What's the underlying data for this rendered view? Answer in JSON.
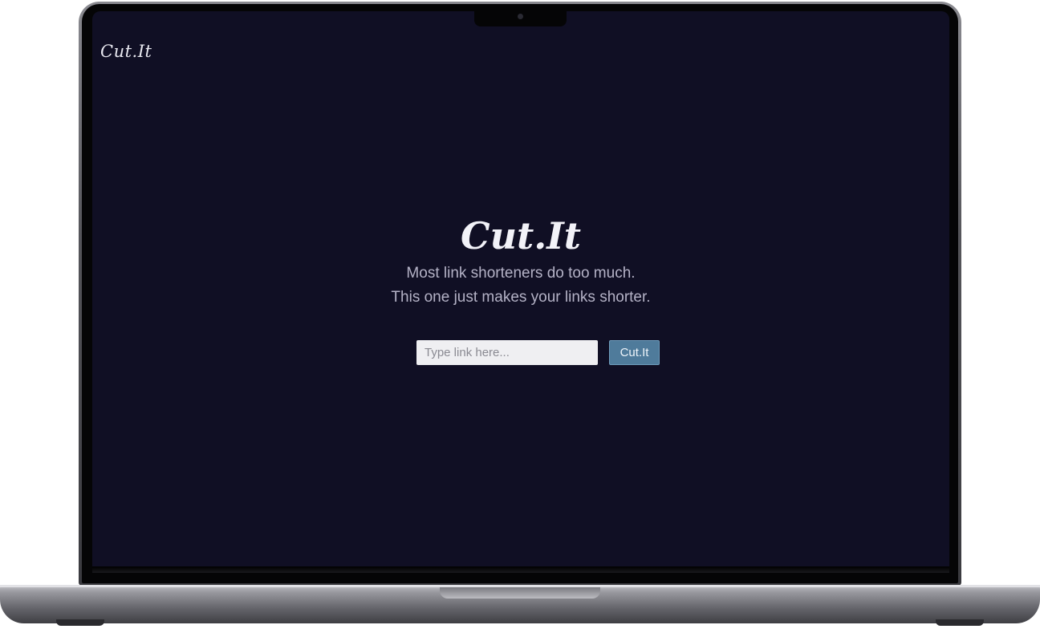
{
  "app": {
    "logo_text": "Cut.It"
  },
  "hero": {
    "title": "Cut.It",
    "line1": "Most link shorteners do too much.",
    "line2": "This one just makes your links shorter."
  },
  "form": {
    "input_placeholder": "Type link here...",
    "input_value": "",
    "button_label": "Cut.It"
  },
  "colors": {
    "screen_background": "#100f24",
    "button_background": "#4f7b9b",
    "text_muted": "#b4b2c6"
  }
}
